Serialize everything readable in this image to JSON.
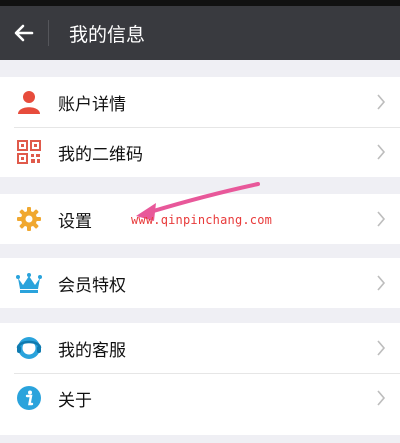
{
  "header": {
    "title": "我的信息"
  },
  "groups": [
    {
      "items": [
        {
          "label": "账户详情",
          "icon": "person-icon"
        },
        {
          "label": "我的二维码",
          "icon": "qr-code-icon"
        }
      ]
    },
    {
      "items": [
        {
          "label": "设置",
          "icon": "gear-icon"
        }
      ]
    },
    {
      "items": [
        {
          "label": "会员特权",
          "icon": "crown-icon"
        }
      ]
    },
    {
      "items": [
        {
          "label": "我的客服",
          "icon": "customer-service-icon"
        },
        {
          "label": "关于",
          "icon": "info-icon"
        }
      ]
    }
  ],
  "watermark": "www.qinpinchang.com",
  "colors": {
    "header_bg": "#393a3f",
    "arrow": "#e8589a"
  }
}
